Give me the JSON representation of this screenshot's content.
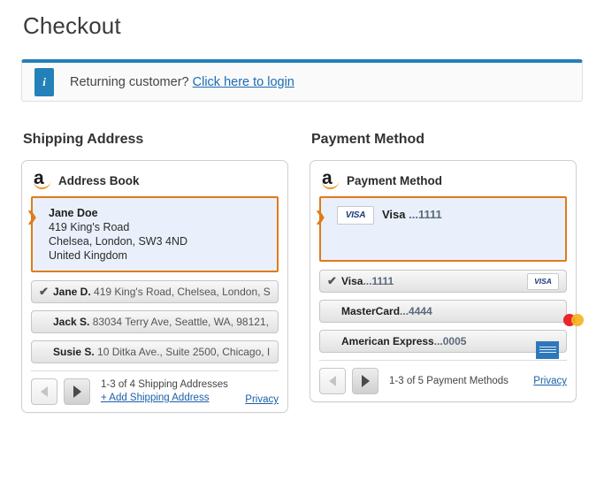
{
  "page_title": "Checkout",
  "alert": {
    "icon": "info-icon",
    "icon_glyph": "i",
    "text": "Returning customer?",
    "link_label": "Click here to login",
    "accent_color": "#2380b8"
  },
  "colors": {
    "selected_border": "#e07b18",
    "selected_background": "#eaf0fb",
    "link": "#1a5fa8",
    "amazon_orange": "#f0951e"
  },
  "shipping": {
    "section_title": "Shipping Address",
    "widget_title": "Address Book",
    "logo": "amazon-logo",
    "selected": {
      "name": "Jane Doe",
      "line1": "419 King's Road",
      "line2": "Chelsea, London, SW3 4ND",
      "line3": "United Kingdom"
    },
    "rows": [
      {
        "selected": true,
        "check": "✔",
        "name": "Jane D.",
        "detail": "419 King's Road, Chelsea, London, S..."
      },
      {
        "selected": false,
        "check": "✔",
        "name": "Jack S.",
        "detail": "83034 Terry Ave, Seattle, WA, 98121, ..."
      },
      {
        "selected": false,
        "check": "✔",
        "name": "Susie S.",
        "detail": "10 Ditka Ave., Suite 2500, Chicago, I..."
      }
    ],
    "footer": {
      "prev_label": "previous page",
      "next_label": "next page",
      "count_text": "1-3 of 4 Shipping Addresses",
      "add_label": "+ Add Shipping Address",
      "privacy_label": "Privacy"
    }
  },
  "payment": {
    "section_title": "Payment Method",
    "widget_title": "Payment Method",
    "logo": "amazon-logo",
    "selected": {
      "brand": "VISA",
      "label": "Visa ",
      "digits": "...1111"
    },
    "rows": [
      {
        "selected": true,
        "check": "✔",
        "label": "Visa",
        "digits": "...1111",
        "brand": "visa"
      },
      {
        "selected": false,
        "check": "✔",
        "label": "MasterCard",
        "digits": "...4444",
        "brand": "mastercard"
      },
      {
        "selected": false,
        "check": "✔",
        "label": "American Express",
        "digits": "...0005",
        "brand": "amex"
      }
    ],
    "footer": {
      "prev_label": "previous page",
      "next_label": "next page",
      "count_text": "1-3 of 5 Payment Methods",
      "privacy_label": "Privacy"
    }
  }
}
